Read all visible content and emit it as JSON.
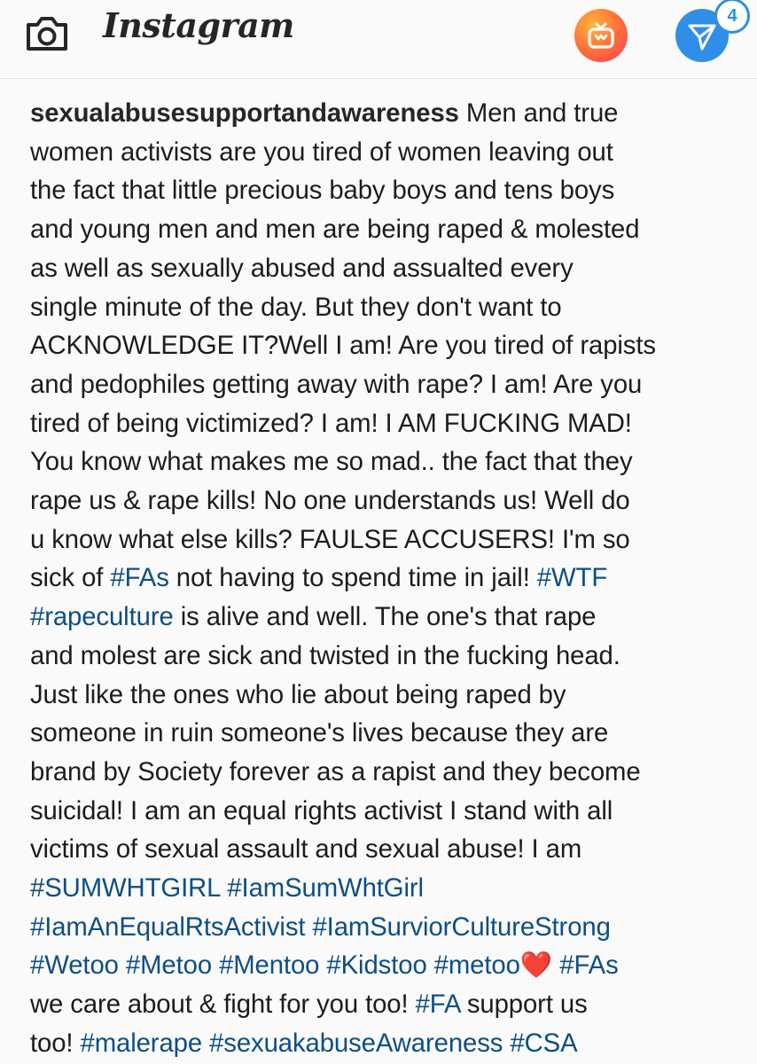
{
  "topbar": {
    "camera_icon": "camera-icon",
    "brand": "Instagram",
    "igtv_icon": "igtv-icon",
    "direct_icon": "direct-message-icon",
    "direct_badge": "4"
  },
  "post": {
    "username": "sexualabusesupportandawareness",
    "l1": " Men and true",
    "l2": "women activists are you tired of women leaving out",
    "l3": "the fact that little precious baby boys and tens boys",
    "l4": "and young men and men are being raped & molested",
    "l5": "as well as sexually abused and assualted every",
    "l6": "single minute of the day. But they don't want to",
    "l7": "ACKNOWLEDGE IT?Well I am! Are you tired of rapists",
    "l8": "and pedophiles getting away with rape? I am! Are you",
    "l9": "tired of being victimized? I am! I AM FUCKING MAD!",
    "l10": "You know what makes me so mad.. the fact that they",
    "l11": "rape us & rape kills! No one understands us! Well do",
    "l12": "u know what else kills? FAULSE ACCUSERS! I'm so",
    "l13a": "sick of ",
    "tag_fas": "#FAs",
    "l13b": " not having to spend time in jail! ",
    "tag_wtf": "#WTF",
    "tag_rapeculture": "#rapeculture",
    "l14": " is alive and well. The one's that rape",
    "l15": "and molest are sick and twisted in the  fucking head.",
    "l16": "Just like the ones who lie about being raped by",
    "l17": "someone in ruin someone's lives because they are",
    "l18": "brand by Society forever as a rapist and they become",
    "l19": "suicidal! I am an equal rights activist I stand with all",
    "l20": "victims of sexual assault and sexual abuse! I am",
    "tag_sumwhtgirl": "#SUMWHTGIRL",
    "tag_iamsumwhtgirl": "#IamSumWhtGirl",
    "tag_equalrts": "#IamAnEqualRtsActivist",
    "tag_survior": "#IamSurviorCultureStrong",
    "tag_wetoo": "#Wetoo",
    "tag_metoo": "#Metoo",
    "tag_mentoo": "#Mentoo",
    "tag_kidstoo": "#Kidstoo",
    "tag_metoo2": "#metoo",
    "heart": "❤️",
    "tag_fas2": "#FAs",
    "l25a": "we care about & fight for you too!  ",
    "tag_fa": "#FA",
    "l25b": " support us",
    "l26a": "too! ",
    "tag_malerape": "#malerape",
    "tag_awareness": "#sexuakabuseAwareness",
    "tag_csa": "#CSA"
  }
}
